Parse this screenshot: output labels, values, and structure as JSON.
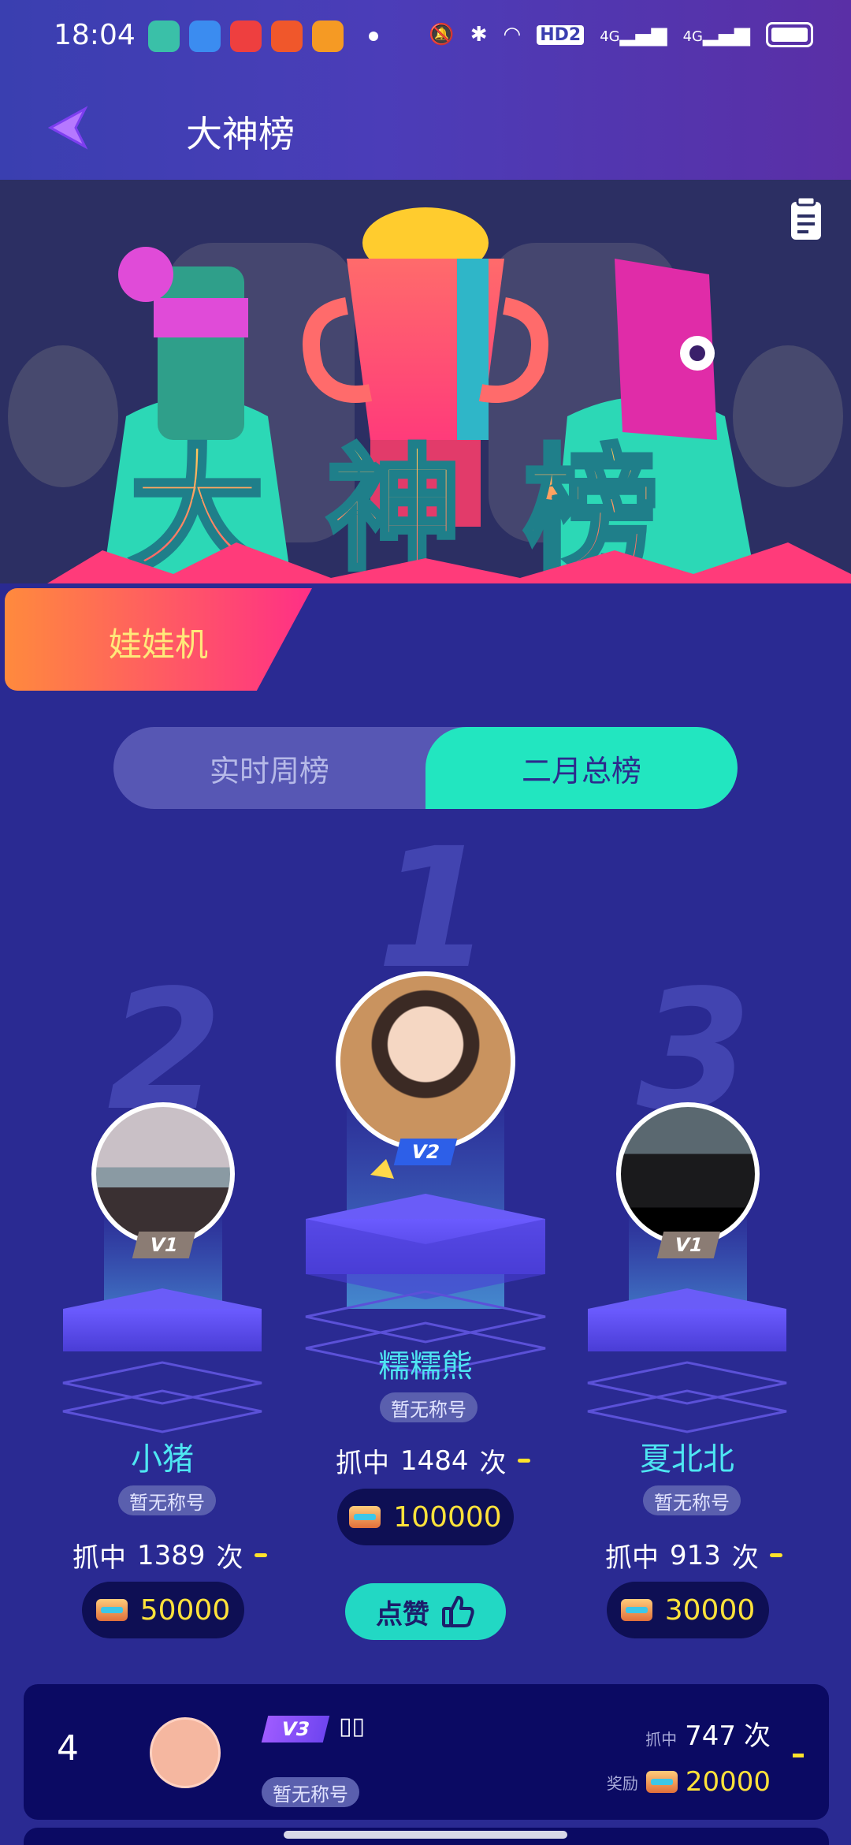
{
  "status_bar": {
    "time": "18:04",
    "network_label": "HD2",
    "signal_1": "4G",
    "signal_2": "4G"
  },
  "header": {
    "title": "大神榜"
  },
  "banner": {
    "title": "大神榜"
  },
  "category": {
    "label": "娃娃机"
  },
  "tabs": [
    {
      "label": "实时周榜",
      "active": false
    },
    {
      "label": "二月总榜",
      "active": true
    }
  ],
  "podium": {
    "first": {
      "rank": "1",
      "name": "糯糯熊",
      "level": "V2",
      "title": "暂无称号",
      "catch_prefix": "抓中",
      "catch_count": "1484",
      "catch_suffix": "次",
      "reward": "100000"
    },
    "second": {
      "rank": "2",
      "name": "小猪",
      "level": "V1",
      "title": "暂无称号",
      "catch_prefix": "抓中",
      "catch_count": "1389",
      "catch_suffix": "次",
      "reward": "50000"
    },
    "third": {
      "rank": "3",
      "name": "夏北北",
      "level": "V1",
      "title": "暂无称号",
      "catch_prefix": "抓中",
      "catch_count": "913",
      "catch_suffix": "次",
      "reward": "30000"
    }
  },
  "like_button": {
    "label": "点赞"
  },
  "list": [
    {
      "rank": "4",
      "level": "V3",
      "name": "▯▯",
      "title": "暂无称号",
      "catch_label": "抓中",
      "catch_count": "747",
      "catch_suffix": "次",
      "reward_label": "奖励",
      "reward": "20000"
    }
  ],
  "colors": {
    "background": "#2a2a92",
    "accent_teal": "#22e6c0",
    "name_cyan": "#4ee6f2",
    "reward_yellow": "#ffe23a",
    "category_gradient": [
      "#ff8a3d",
      "#ff2f86"
    ]
  }
}
